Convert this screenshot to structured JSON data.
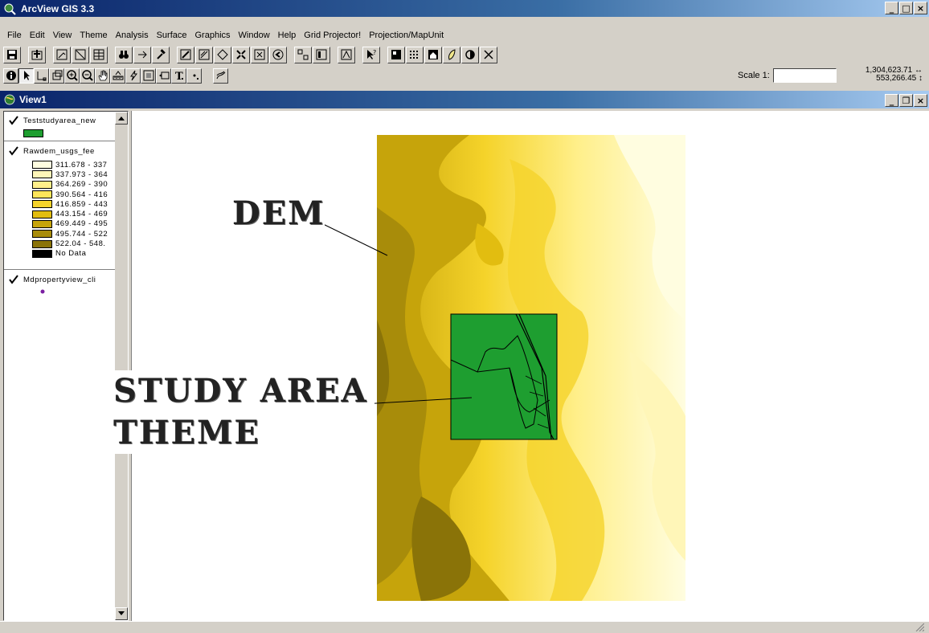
{
  "app": {
    "title": "ArcView GIS 3.3"
  },
  "menu": [
    "File",
    "Edit",
    "View",
    "Theme",
    "Analysis",
    "Surface",
    "Graphics",
    "Window",
    "Help",
    "Grid Projector!",
    "Projection/MapUnit"
  ],
  "toolbar": {
    "scale_label": "Scale 1:",
    "scale_value": "",
    "x_coord": "1,304,623.71",
    "y_coord": "553,266.45"
  },
  "view": {
    "title": "View1"
  },
  "legend": {
    "themes": [
      {
        "name": "Teststudyarea_new",
        "checked": true,
        "color": "#1e9e30"
      },
      {
        "name": "Rawdem_usgs_fee",
        "checked": true
      },
      {
        "name": "Mdpropertyview_cli",
        "checked": true,
        "color": "#7b1fa2"
      }
    ],
    "classes": [
      {
        "label": "311.678 - 337",
        "color": "#fffde0"
      },
      {
        "label": "337.973 - 364",
        "color": "#fff6b8"
      },
      {
        "label": "364.269 - 390",
        "color": "#ffef8a"
      },
      {
        "label": "390.564 - 416",
        "color": "#ffe65a"
      },
      {
        "label": "416.859 - 443",
        "color": "#f5d32a"
      },
      {
        "label": "443.154 - 469",
        "color": "#e2bd10"
      },
      {
        "label": "469.449 - 495",
        "color": "#c6a40b"
      },
      {
        "label": "495.744 - 522",
        "color": "#a88c0a"
      },
      {
        "label": "522.04 - 548.",
        "color": "#8a7308"
      },
      {
        "label": "No Data",
        "color": "#000000"
      }
    ]
  },
  "annotations": {
    "dem": "DEM",
    "study_area_line1": "STUDY AREA",
    "study_area_line2": "THEME"
  }
}
